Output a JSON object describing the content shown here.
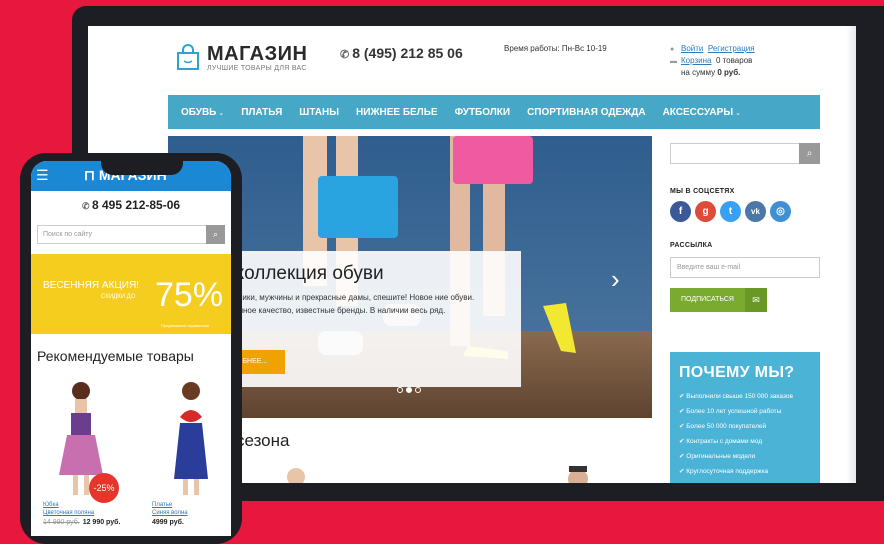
{
  "header": {
    "logo_title": "МАГАЗИН",
    "logo_tagline": "ЛУЧШИЕ ТОВАРЫ ДЛЯ ВАС",
    "phone": "8 (495) 212 85 06",
    "hours": "Время работы: Пн-Вс 10-19",
    "login": "Войти",
    "register": "Регистрация",
    "cart_link": "Корзина",
    "cart_items": "0 товаров",
    "cart_sum_label": "на сумму",
    "cart_sum": "0 руб."
  },
  "nav": {
    "items": [
      {
        "label": "ОБУВЬ",
        "has_dropdown": true
      },
      {
        "label": "ПЛАТЬЯ",
        "has_dropdown": false
      },
      {
        "label": "ШТАНЫ",
        "has_dropdown": false
      },
      {
        "label": "НИЖНЕЕ БЕЛЬЕ",
        "has_dropdown": false
      },
      {
        "label": "ФУТБОЛКИ",
        "has_dropdown": false
      },
      {
        "label": "СПОРТИВНАЯ ОДЕЖДА",
        "has_dropdown": false
      },
      {
        "label": "АКСЕССУАРЫ",
        "has_dropdown": true
      }
    ]
  },
  "hero": {
    "title": "я коллекция обуви",
    "text": "мальчики, мужчины и прекрасные дамы, спешите! Новое ние обуви. Отличное качество, известные бренды. В наличии весь ряд.",
    "button": "ОБНЕЕ...",
    "slides": 3,
    "active_slide": 2
  },
  "section": {
    "season_title": "сезона"
  },
  "sidebar": {
    "search_placeholder": "",
    "social_heading": "МЫ В СОЦСЕТЯХ",
    "socials": [
      {
        "icon": "facebook-icon",
        "glyph": "f",
        "color": "#3b5998"
      },
      {
        "icon": "google-plus-icon",
        "glyph": "g",
        "color": "#dd4b39"
      },
      {
        "icon": "twitter-icon",
        "glyph": "t",
        "color": "#38a1f3"
      },
      {
        "icon": "vk-icon",
        "glyph": "vk",
        "color": "#4a76a8"
      },
      {
        "icon": "instagram-icon",
        "glyph": "◎",
        "color": "#3f8fd2"
      }
    ],
    "newsletter_heading": "РАССЫЛКА",
    "email_placeholder": "Введите ваш e-mail",
    "subscribe": "ПОДПИСАТЬСЯ",
    "why_title": "ПОЧЕМУ МЫ?",
    "why_items": [
      "Выполнили свыше 150 000 заказов",
      "Более 10 лет успешной работы",
      "Более 50 000 покупателей",
      "Контракты с домами мод",
      "Оригинальные модели",
      "Круглосуточная поддержка"
    ]
  },
  "mobile": {
    "logo": "МАГАЗИН",
    "phone": "8 495 212-85-06",
    "search_placeholder": "Поиск по сайту",
    "promo_title": "ВЕСЕННЯЯ АКЦИЯ!",
    "promo_sub": "СКИДКИ ДО",
    "promo_value": "75%",
    "promo_small": "Предложение ограничено",
    "recommended": "Рекомендуемые товары",
    "products": [
      {
        "name_1": "Юбка",
        "name_2": "Цветочная поляна",
        "old_price": "14 990 руб.",
        "price": "12 990 руб.",
        "badge": "-25%"
      },
      {
        "name_1": "Платье",
        "name_2": "Синяя волна",
        "price": "4999 руб."
      }
    ]
  }
}
